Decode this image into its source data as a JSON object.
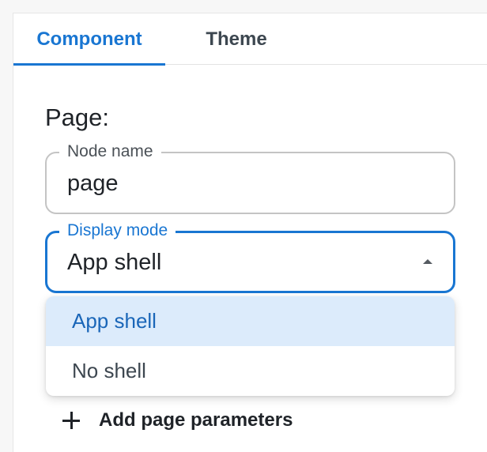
{
  "tabs": [
    {
      "label": "Component",
      "active": true
    },
    {
      "label": "Theme",
      "active": false
    }
  ],
  "section_title": "Page:",
  "node_name_field": {
    "label": "Node name",
    "value": "page"
  },
  "display_mode_field": {
    "label": "Display mode",
    "value": "App shell",
    "options": [
      "App shell",
      "No shell"
    ],
    "selected_index": 0
  },
  "add_parameters": {
    "label": "Add page parameters",
    "icon": "plus-icon"
  },
  "colors": {
    "accent": "#1976d2",
    "selected_option_bg": "#dcebfb"
  }
}
